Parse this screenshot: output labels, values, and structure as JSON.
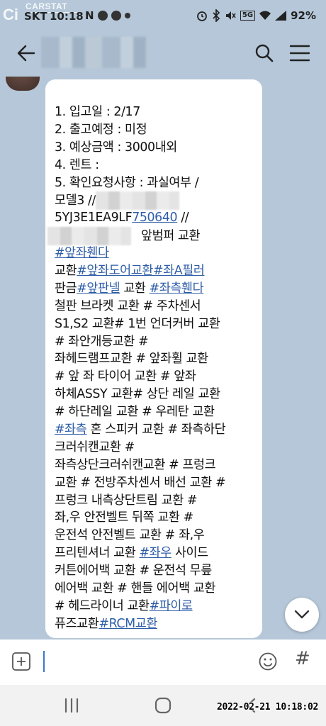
{
  "watermark": {
    "logo": "Ci",
    "brand": "CARSTAT"
  },
  "status_bar": {
    "carrier": "SKT",
    "time": "10:18",
    "notification": "N",
    "signal_badge": "5G",
    "battery": "92%",
    "icons": [
      "alarm-icon",
      "bluetooth-icon",
      "mute-icon",
      "wifi-icon",
      "signal-icon",
      "battery-icon"
    ]
  },
  "header": {
    "icons": [
      "back-arrow-icon",
      "search-icon",
      "menu-icon"
    ]
  },
  "message": {
    "lines": [
      {
        "parts": [
          {
            "t": "1. 입고일 :  2/17"
          }
        ]
      },
      {
        "parts": [
          {
            "t": "2. 출고예정 : 미정"
          }
        ]
      },
      {
        "parts": [
          {
            "t": "3. 예상금액 :  3000내외"
          }
        ]
      },
      {
        "parts": [
          {
            "t": "4. 렌트 :"
          }
        ]
      },
      {
        "parts": [
          {
            "t": "5. 확인요청사항 : 과실여부 /"
          }
        ]
      },
      {
        "parts": [
          {
            "t": "모델3 //"
          }
        ]
      },
      {
        "parts": [
          {
            "t": "5YJ3E1EA9LF"
          },
          {
            "t": "750640",
            "link": true
          },
          {
            "t": " //"
          }
        ]
      },
      {
        "parts": [
          {
            "t": "앞범퍼 교환"
          }
        ]
      },
      {
        "parts": [
          {
            "t": "#앞좌휀다",
            "tag": true
          }
        ]
      },
      {
        "parts": [
          {
            "t": "교환"
          },
          {
            "t": "#앞좌도어교환#좌A필러",
            "tag": true
          }
        ]
      },
      {
        "parts": [
          {
            "t": "판금"
          },
          {
            "t": "#앞판넬",
            "tag": true
          },
          {
            "t": " 교환 "
          },
          {
            "t": "#좌측휀다",
            "tag": true
          }
        ]
      },
      {
        "parts": [
          {
            "t": "철판 브라켓 교환 # 주차센서"
          }
        ]
      },
      {
        "parts": [
          {
            "t": "S1,S2 교환# 1번 언더커버 교환"
          }
        ]
      },
      {
        "parts": [
          {
            "t": "# 좌안개등교환  #"
          }
        ]
      },
      {
        "parts": [
          {
            "t": "좌헤드램프교환 #   앞좌휠 교환"
          }
        ]
      },
      {
        "parts": [
          {
            "t": "# 앞 좌 타이어 교환 # 앞좌"
          }
        ]
      },
      {
        "parts": [
          {
            "t": "하체ASSY 교환# 상단 레일 교환"
          }
        ]
      },
      {
        "parts": [
          {
            "t": "# 하단레일 교환 # 우레탄 교환"
          }
        ]
      },
      {
        "parts": [
          {
            "t": "#좌측",
            "tag": true
          },
          {
            "t": " 혼 스피커 교환 # 좌측하단"
          }
        ]
      },
      {
        "parts": [
          {
            "t": "크러쉬캔교환 #"
          }
        ]
      },
      {
        "parts": [
          {
            "t": "좌측상단크러쉬캔교환 # 프렁크"
          }
        ]
      },
      {
        "parts": [
          {
            "t": "교환 # 전방주차센서 배선 교환 #"
          }
        ]
      },
      {
        "parts": [
          {
            "t": "프렁크 내측상단트림 교환 #"
          }
        ]
      },
      {
        "parts": [
          {
            "t": "좌,우 안전벨트 뒤쪽 교환 #"
          }
        ]
      },
      {
        "parts": [
          {
            "t": "운전석 안전벨트 교환 # 좌,우"
          }
        ]
      },
      {
        "parts": [
          {
            "t": "프리텐셔너 교환 "
          },
          {
            "t": "#좌우",
            "tag": true
          },
          {
            "t": " 사이드"
          }
        ]
      },
      {
        "parts": [
          {
            "t": "커튼에어백 교환 # 운전석 무릎"
          }
        ]
      },
      {
        "parts": [
          {
            "t": "에어백 교환 # 핸들 에어백 교환"
          }
        ]
      },
      {
        "parts": [
          {
            "t": "# 헤드라이너 교환"
          },
          {
            "t": "#파이로",
            "tag": true
          }
        ]
      },
      {
        "parts": [
          {
            "t": "퓨즈교환"
          },
          {
            "t": "#RCM교환",
            "tag": true
          }
        ]
      }
    ]
  },
  "input_bar": {
    "placeholder": "",
    "hash_label": "#",
    "icons": [
      "plus-icon",
      "emoji-icon"
    ]
  },
  "nav_bar": {
    "icons": [
      "recent-apps-icon",
      "home-icon",
      "back-icon"
    ],
    "capture_timestamp": "2022-02-21 10:18:02"
  }
}
